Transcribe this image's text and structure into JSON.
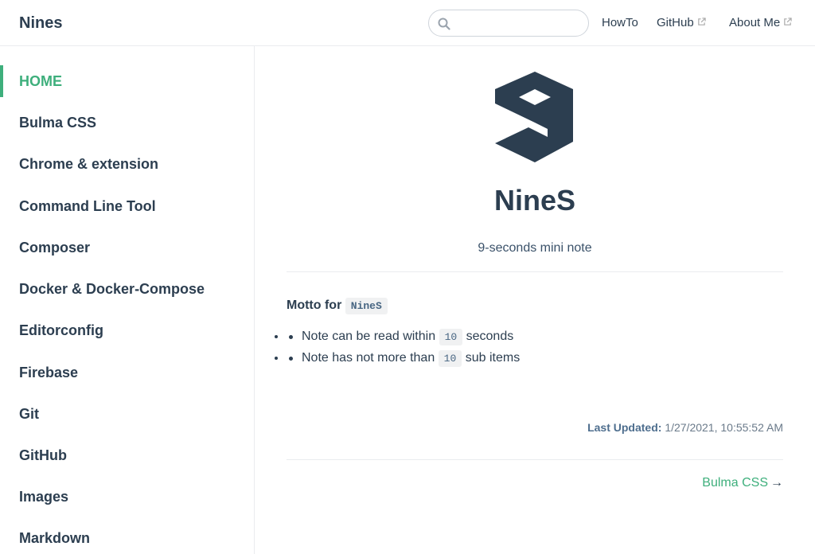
{
  "navbar": {
    "site_name": "Nines",
    "search": {
      "value": "",
      "placeholder": ""
    },
    "links": [
      {
        "label": "HowTo",
        "external": false
      },
      {
        "label": "GitHub",
        "external": true
      },
      {
        "label": "About Me",
        "external": true
      }
    ]
  },
  "sidebar": {
    "items": [
      {
        "label": "HOME",
        "active": true
      },
      {
        "label": "Bulma CSS"
      },
      {
        "label": "Chrome & extension"
      },
      {
        "label": "Command Line Tool"
      },
      {
        "label": "Composer"
      },
      {
        "label": "Docker & Docker-Compose"
      },
      {
        "label": "Editorconfig"
      },
      {
        "label": "Firebase"
      },
      {
        "label": "Git"
      },
      {
        "label": "GitHub"
      },
      {
        "label": "Images"
      },
      {
        "label": "Markdown"
      }
    ]
  },
  "main": {
    "hero": {
      "title": "NineS",
      "description": "9-seconds mini note"
    },
    "motto": {
      "label": "Motto for",
      "code": "NineS"
    },
    "bullets": [
      {
        "before": "Note can be read within",
        "code": "10",
        "after": "seconds"
      },
      {
        "before": "Note has not more than",
        "code": "10",
        "after": "sub items"
      }
    ],
    "last_updated": {
      "label": "Last Updated:",
      "value": "1/27/2021, 10:55:52 AM"
    },
    "next": {
      "label": "Bulma CSS",
      "arrow": "→"
    }
  },
  "colors": {
    "accent": "#3eaf7c",
    "text": "#2c3e50",
    "border": "#eaecef",
    "logo": "#2c3e50"
  },
  "icons": {
    "search": "search-icon",
    "external": "external-link-icon",
    "logo": "nines-logo"
  }
}
